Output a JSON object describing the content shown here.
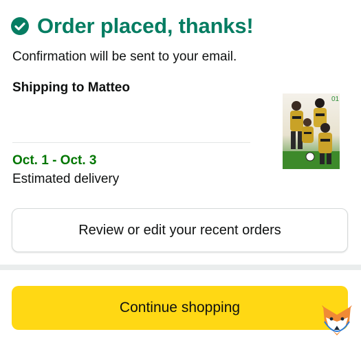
{
  "confirmation": {
    "title": "Order placed, thanks!",
    "message": "Confirmation will be sent to your email.",
    "shipping": "Shipping to Matteo",
    "delivery_dates": "Oct. 1 - Oct. 3",
    "delivery_label": "Estimated delivery",
    "status_color": "#067d62",
    "date_color": "#007600"
  },
  "product": {
    "thumbnail_icon": "manga-cover-thumbnail",
    "volume_badge": "01"
  },
  "actions": {
    "review_label": "Review or edit your recent orders",
    "continue_label": "Continue shopping",
    "continue_color": "#ffd814"
  },
  "watermark": {
    "icon": "fox-logo-icon"
  }
}
